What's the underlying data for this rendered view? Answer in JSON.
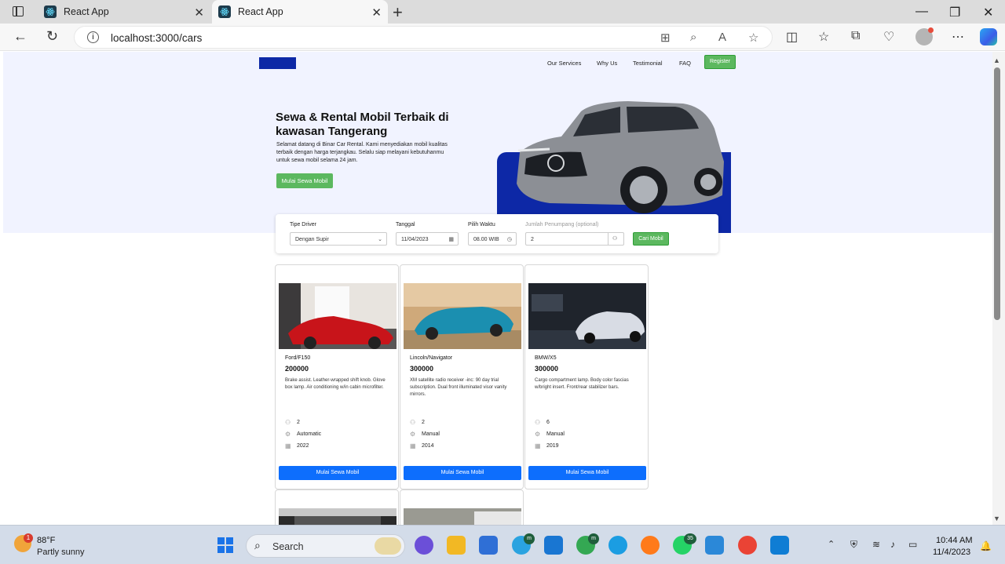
{
  "browser": {
    "tabs": [
      {
        "title": "React App"
      },
      {
        "title": "React App"
      }
    ],
    "url": "localhost:3000/cars"
  },
  "site": {
    "nav": [
      "Our Services",
      "Why Us",
      "Testimonial",
      "FAQ"
    ],
    "register_label": "Register",
    "hero": {
      "title": "Sewa & Rental Mobil Terbaik di kawasan Tangerang",
      "description": "Selamat datang di Binar Car Rental. Kami menyediakan mobil kualitas terbaik dengan harga terjangkau. Selalu siap melayani kebutuhanmu untuk sewa mobil selama 24 jam.",
      "cta": "Mulai Sewa Mobil"
    },
    "search": {
      "driver_label": "Tipe Driver",
      "driver_value": "Dengan Supir",
      "date_label": "Tanggal",
      "date_value": "11/04/2023",
      "time_label": "Pilih Waktu",
      "time_value": "08.00 WIB",
      "passengers_label": "Jumlah Penumpang (optional)",
      "passengers_value": "2",
      "button": "Cari Mobil"
    },
    "cars": [
      {
        "name": "Ford/F150",
        "price": "200000",
        "description": "Brake assist. Leather-wrapped shift knob. Glove box lamp. Air conditioning w/in cabin microfilter.",
        "capacity": "2",
        "transmission": "Automatic",
        "year": "2022",
        "button": "Mulai Sewa Mobil",
        "color": "#c8141a"
      },
      {
        "name": "Lincoln/Navigator",
        "price": "300000",
        "description": "XM satellite radio receiver -inc: 90 day trial subscription. Dual front illuminated visor vanity mirrors.",
        "capacity": "2",
        "transmission": "Manual",
        "year": "2014",
        "button": "Mulai Sewa Mobil",
        "color": "#1b8fb0"
      },
      {
        "name": "BMW/X5",
        "price": "300000",
        "description": "Cargo compartment lamp. Body color fascias w/bright insert. Front/rear stabilizer bars.",
        "capacity": "6",
        "transmission": "Manual",
        "year": "2019",
        "button": "Mulai Sewa Mobil",
        "color": "#d8dce4"
      }
    ]
  },
  "taskbar": {
    "temperature": "88°F",
    "condition": "Partly sunny",
    "weather_badge": "1",
    "search_label": "Search",
    "telegram_badge": "m",
    "chrome_badge": "m",
    "whatsapp_badge": "35",
    "time": "10:44 AM",
    "date": "11/4/2023"
  },
  "colors": {
    "brand_blue": "#0d28a6",
    "green": "#5cb85f",
    "primary": "#0d6efd",
    "hero_bg": "#f1f3ff"
  }
}
